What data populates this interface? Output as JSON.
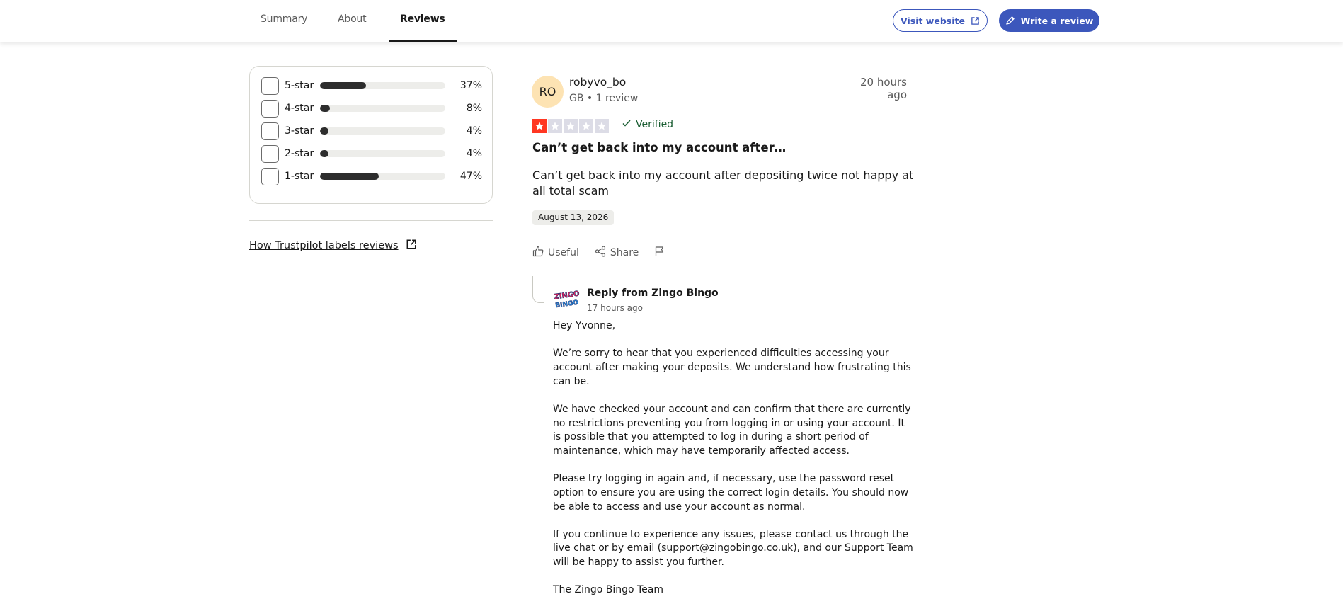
{
  "nav": {
    "tabs": [
      {
        "label": "Summary"
      },
      {
        "label": "About"
      },
      {
        "label": "Reviews"
      }
    ],
    "visit_website": "Visit website",
    "write_review": "Write a review"
  },
  "filters": {
    "rows": [
      {
        "label": "5-star",
        "percent_text": "37%",
        "percent": 37
      },
      {
        "label": "4-star",
        "percent_text": "8%",
        "percent": 8
      },
      {
        "label": "3-star",
        "percent_text": "4%",
        "percent": 4
      },
      {
        "label": "2-star",
        "percent_text": "4%",
        "percent": 4
      },
      {
        "label": "1-star",
        "percent_text": "47%",
        "percent": 47
      }
    ],
    "labels_link": "How Trustpilot labels reviews"
  },
  "review": {
    "avatar_initials": "RO",
    "author": "robyvo_bo",
    "meta": "GB • 1 review",
    "time": "20 hours ago",
    "rating": 1,
    "verified": "Verified",
    "title": "Can’t get back into my account after…",
    "body": "Can’t get back into my account after depositing twice not happy at all total scam",
    "date": "August 13, 2026",
    "actions": {
      "useful": "Useful",
      "share": "Share"
    }
  },
  "reply": {
    "from": "Reply from Zingo Bingo",
    "time": "17 hours ago",
    "logo_text_top": "ZINGO",
    "logo_text_bottom": "BINGO",
    "paragraphs": [
      "Hey Yvonne,",
      "We’re sorry to hear that you experienced difficulties accessing your account after making your deposits. We understand how frustrating this can be.",
      "We have checked your account and can confirm that there are currently no restrictions preventing you from logging in or using your account. It is possible that you attempted to log in during a short period of maintenance, which may have temporarily affected access.",
      "Please try logging in again and, if necessary, use the password reset option to ensure you are using the correct login details. You should now be able to access and use your account as normal.",
      "If you continue to experience any issues, please contact us through the live chat or by email (support@zingobingo.co.uk), and our Support Team will be happy to assist you further.",
      "The Zingo Bingo Team"
    ]
  },
  "colors": {
    "accent": "#3c57bc",
    "star_on": "#ff3722",
    "star_off": "#dcdce6",
    "verified": "#1b5e33",
    "avatar_bg": "#fde3b3"
  }
}
